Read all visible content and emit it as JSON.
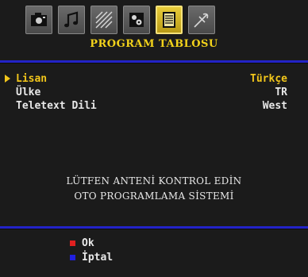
{
  "menu": {
    "tabs": [
      {
        "icon": "camera-icon",
        "selected": false
      },
      {
        "icon": "music-note-icon",
        "selected": false
      },
      {
        "icon": "pattern-icon",
        "selected": false
      },
      {
        "icon": "settings-icon",
        "selected": false
      },
      {
        "icon": "program-table-icon",
        "selected": true
      },
      {
        "icon": "satellite-icon",
        "selected": false
      }
    ],
    "title": "PROGRAM TABLOSU"
  },
  "settings": [
    {
      "label": "Lisan",
      "value": "Türkçe"
    },
    {
      "label": "Ülke",
      "value": "TR"
    },
    {
      "label": "Teletext Dili",
      "value": "West"
    }
  ],
  "message": {
    "line1": "LÜTFEN ANTENİ KONTROL EDİN",
    "line2": "OTO PROGRAMLAMA SİSTEMİ"
  },
  "legend": {
    "ok_label": "Ok",
    "cancel_label": "İptal",
    "ok_color": "#e02020",
    "cancel_color": "#2020e0"
  },
  "colors": {
    "accent": "#f2c61b",
    "rule": "#2323c8"
  }
}
